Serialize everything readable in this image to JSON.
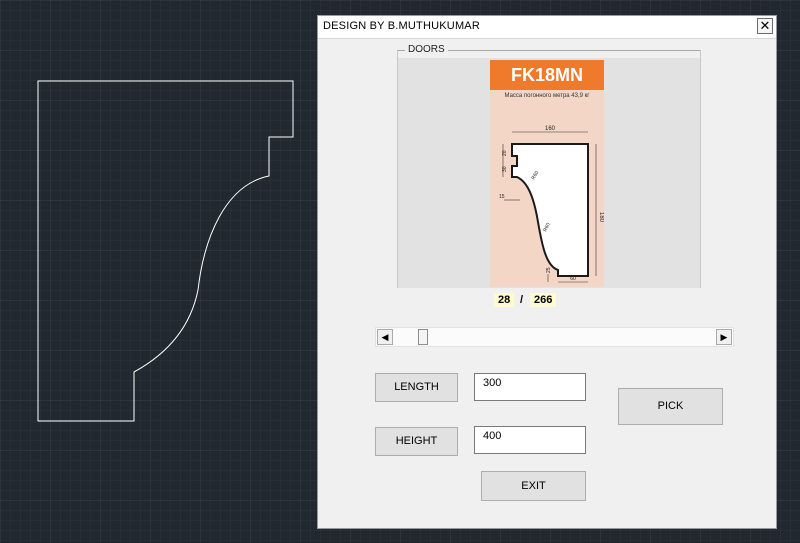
{
  "window": {
    "title": "DESIGN  BY  B.MUTHUKUMAR",
    "close_icon": "close-icon"
  },
  "frame": {
    "label": "DOORS"
  },
  "catalog": {
    "code": "FK18MN",
    "subtitle": "Масса погонного метра 43,9 кг",
    "dims": {
      "top": "160",
      "right": "180",
      "left_top": "20",
      "left_mid": "30",
      "left_low": "15",
      "bottom_left": "25",
      "bottom": "60",
      "r1": "R60",
      "r2": "R60"
    },
    "accent": "#ef7a2c"
  },
  "counter": {
    "current": "28",
    "separator": "/",
    "total": "266"
  },
  "scrollbar": {
    "position": 0.08
  },
  "buttons": {
    "length": "LENGTH",
    "height": "HEIGHT",
    "pick": "PICK",
    "exit": "EXIT"
  },
  "inputs": {
    "length_value": "300",
    "height_value": "400"
  }
}
